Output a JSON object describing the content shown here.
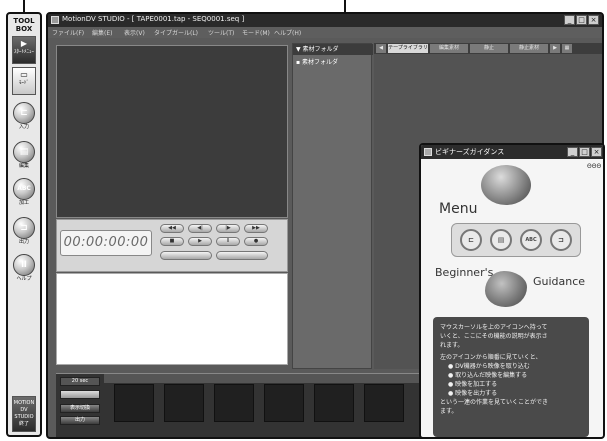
{
  "toolbox": {
    "title_line1": "TOOL",
    "title_line2": "BOX",
    "items": [
      {
        "label": "ｽﾀｰﾄﾒﾆｭｰ"
      },
      {
        "label": "ﾓｰﾄﾞ"
      },
      {
        "label": "入力"
      },
      {
        "label": "編集"
      },
      {
        "label": "加工"
      },
      {
        "label": "出力"
      },
      {
        "label": "ヘルプ"
      }
    ],
    "abc_glyph": "ABC",
    "end_button_label": "MOTION DV STUDIO 終了"
  },
  "main_window": {
    "title": "MotionDV STUDIO - [ TAPE0001.tap - SEQ0001.seq ]",
    "menu": [
      "ファイル(F)",
      "編集(E)",
      "表示(V)",
      "タイプガール(L)",
      "ツール(T)",
      "モード(M)",
      "ヘルプ(H)"
    ],
    "timecode": "00:00:00:00",
    "folders": [
      {
        "label": "素材フォルダ"
      },
      {
        "label": "素材フォルダ"
      }
    ],
    "tabs": [
      "テープライブラリ",
      "編集素材",
      "静止",
      "静止素材"
    ],
    "timeline": {
      "field_value": "20 sec",
      "button_display_switch": "表示切換",
      "button_output": "出力"
    }
  },
  "guidance_window": {
    "title": "ビギナーズガイダンス",
    "menu_heading": "Menu",
    "beginners_label": "Beginner's",
    "guidance_label": "Guidance",
    "lines": [
      "マウスカーソルを上のアイコンへ持って",
      "いくと、ここにその機能の説明が表示さ",
      "れます。",
      "左のアイコンから順番に見ていくと、",
      "DV機器から映像を取り込む",
      "取り込んだ映像を編集する",
      "映像を加工する",
      "映像を出力する",
      "という一連の作業を見ていくことができ",
      "ます。"
    ]
  }
}
